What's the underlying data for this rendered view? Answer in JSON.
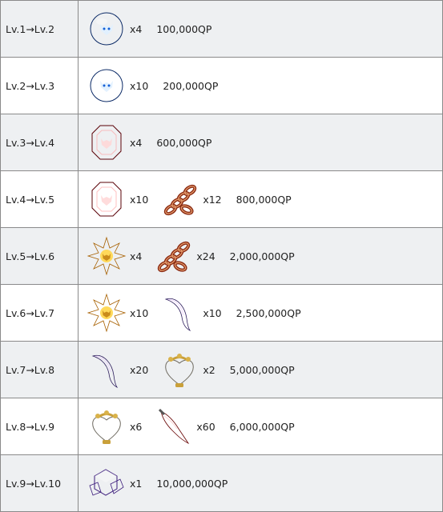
{
  "rows": [
    {
      "level": "Lv.1→Lv.2",
      "materials": [
        {
          "icon": "blue-gem-icon",
          "qty": "x4"
        }
      ],
      "qp": "100,000QP"
    },
    {
      "level": "Lv.2→Lv.3",
      "materials": [
        {
          "icon": "blue-gem-icon",
          "qty": "x10"
        }
      ],
      "qp": "200,000QP"
    },
    {
      "level": "Lv.3→Lv.4",
      "materials": [
        {
          "icon": "red-gem-icon",
          "qty": "x4"
        }
      ],
      "qp": "600,000QP"
    },
    {
      "level": "Lv.4→Lv.5",
      "materials": [
        {
          "icon": "red-gem-icon",
          "qty": "x10"
        },
        {
          "icon": "chain-icon",
          "qty": "x12"
        }
      ],
      "qp": "800,000QP"
    },
    {
      "level": "Lv.5→Lv.6",
      "materials": [
        {
          "icon": "gold-gem-icon",
          "qty": "x4"
        },
        {
          "icon": "chain-icon",
          "qty": "x24"
        }
      ],
      "qp": "2,000,000QP"
    },
    {
      "level": "Lv.6→Lv.7",
      "materials": [
        {
          "icon": "gold-gem-icon",
          "qty": "x10"
        },
        {
          "icon": "claw-icon",
          "qty": "x10"
        }
      ],
      "qp": "2,500,000QP"
    },
    {
      "level": "Lv.7→Lv.8",
      "materials": [
        {
          "icon": "claw-icon",
          "qty": "x20"
        },
        {
          "icon": "heart-urn-icon",
          "qty": "x2"
        }
      ],
      "qp": "5,000,000QP"
    },
    {
      "level": "Lv.8→Lv.9",
      "materials": [
        {
          "icon": "heart-urn-icon",
          "qty": "x6"
        },
        {
          "icon": "red-fang-icon",
          "qty": "x60"
        }
      ],
      "qp": "6,000,000QP"
    },
    {
      "level": "Lv.9→Lv.10",
      "materials": [
        {
          "icon": "crystal-cube-icon",
          "qty": "x1"
        }
      ],
      "qp": "10,000,000QP"
    }
  ]
}
